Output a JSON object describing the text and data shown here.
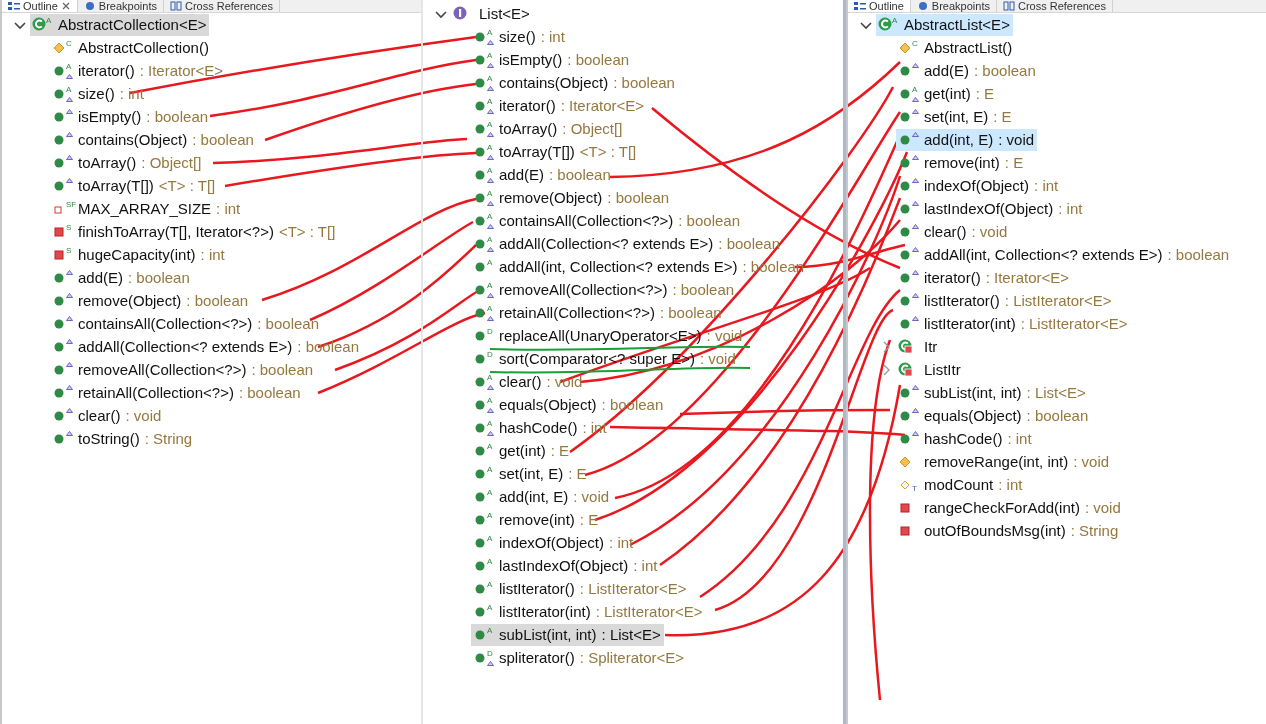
{
  "panels": [
    {
      "focused": false,
      "tabs": [
        {
          "label": "Outline",
          "kind": "outline",
          "closable": true,
          "selected": true
        },
        {
          "label": "Breakpoints",
          "kind": "breakpoints",
          "closable": false,
          "selected": false
        },
        {
          "label": "Cross References",
          "kind": "references",
          "closable": false,
          "selected": false
        }
      ],
      "tree": {
        "kind": "class",
        "badge": "A",
        "overrides": false,
        "name": "AbstractCollection<E>",
        "selected": true,
        "expanded": true,
        "children": [
          {
            "kind": "protected-method",
            "badge": "C",
            "overrides": false,
            "name": "AbstractCollection()",
            "selected": false
          },
          {
            "kind": "public-method",
            "badge": "A",
            "overrides": true,
            "name": "iterator()",
            "suffix": ": Iterator<E>",
            "selected": false
          },
          {
            "kind": "public-method",
            "badge": "A",
            "overrides": true,
            "name": "size()",
            "suffix": ": int",
            "selected": false
          },
          {
            "kind": "public-method",
            "overrides": true,
            "name": "isEmpty()",
            "suffix": ": boolean",
            "selected": false
          },
          {
            "kind": "public-method",
            "overrides": true,
            "name": "contains(Object)",
            "suffix": ": boolean",
            "selected": false
          },
          {
            "kind": "public-method",
            "overrides": true,
            "name": "toArray()",
            "suffix": ": Object[]",
            "selected": false
          },
          {
            "kind": "public-method",
            "overrides": true,
            "name": "toArray(T[])",
            "suffix": "<T> : T[]",
            "selected": false
          },
          {
            "kind": "private-field",
            "badge": "SF",
            "overrides": false,
            "name": "MAX_ARRAY_SIZE",
            "suffix": ": int",
            "selected": false
          },
          {
            "kind": "private-method",
            "badge": "S",
            "overrides": false,
            "name": "finishToArray(T[], Iterator<?>)",
            "suffix": "<T> : T[]",
            "selected": false
          },
          {
            "kind": "private-method",
            "badge": "S",
            "overrides": false,
            "name": "hugeCapacity(int)",
            "suffix": ": int",
            "selected": false
          },
          {
            "kind": "public-method",
            "overrides": true,
            "name": "add(E)",
            "suffix": ": boolean",
            "selected": false
          },
          {
            "kind": "public-method",
            "overrides": true,
            "name": "remove(Object)",
            "suffix": ": boolean",
            "selected": false
          },
          {
            "kind": "public-method",
            "overrides": true,
            "name": "containsAll(Collection<?>)",
            "suffix": ": boolean",
            "selected": false
          },
          {
            "kind": "public-method",
            "overrides": true,
            "name": "addAll(Collection<? extends E>)",
            "suffix": ": boolean",
            "selected": false
          },
          {
            "kind": "public-method",
            "overrides": true,
            "name": "removeAll(Collection<?>)",
            "suffix": ": boolean",
            "selected": false
          },
          {
            "kind": "public-method",
            "overrides": true,
            "name": "retainAll(Collection<?>)",
            "suffix": ": boolean",
            "selected": false
          },
          {
            "kind": "public-method",
            "overrides": true,
            "name": "clear()",
            "suffix": ": void",
            "selected": false
          },
          {
            "kind": "public-method",
            "overrides": true,
            "name": "toString()",
            "suffix": ": String",
            "selected": false
          }
        ]
      }
    },
    {
      "focused": false,
      "tree": {
        "kind": "interface",
        "overrides": false,
        "name": "List<E>",
        "selected": false,
        "expanded": true,
        "children": [
          {
            "kind": "public-method",
            "badge": "A",
            "overrides": true,
            "name": "size()",
            "suffix": ": int",
            "selected": false
          },
          {
            "kind": "public-method",
            "badge": "A",
            "overrides": true,
            "name": "isEmpty()",
            "suffix": ": boolean",
            "selected": false
          },
          {
            "kind": "public-method",
            "badge": "A",
            "overrides": true,
            "name": "contains(Object)",
            "suffix": ": boolean",
            "selected": false
          },
          {
            "kind": "public-method",
            "badge": "A",
            "overrides": true,
            "name": "iterator()",
            "suffix": ": Iterator<E>",
            "selected": false
          },
          {
            "kind": "public-method",
            "badge": "A",
            "overrides": true,
            "name": "toArray()",
            "suffix": ": Object[]",
            "selected": false
          },
          {
            "kind": "public-method",
            "badge": "A",
            "overrides": true,
            "name": "toArray(T[])",
            "suffix": "<T> : T[]",
            "selected": false
          },
          {
            "kind": "public-method",
            "badge": "A",
            "overrides": true,
            "name": "add(E)",
            "suffix": ": boolean",
            "selected": false
          },
          {
            "kind": "public-method",
            "badge": "A",
            "overrides": true,
            "name": "remove(Object)",
            "suffix": ": boolean",
            "selected": false
          },
          {
            "kind": "public-method",
            "badge": "A",
            "overrides": true,
            "name": "containsAll(Collection<?>)",
            "suffix": ": boolean",
            "selected": false
          },
          {
            "kind": "public-method",
            "badge": "A",
            "overrides": true,
            "name": "addAll(Collection<? extends E>)",
            "suffix": ": boolean",
            "selected": false
          },
          {
            "kind": "public-method",
            "badge": "A",
            "overrides": false,
            "name": "addAll(int, Collection<? extends E>)",
            "suffix": ": boolean",
            "selected": false
          },
          {
            "kind": "public-method",
            "badge": "A",
            "overrides": true,
            "name": "removeAll(Collection<?>)",
            "suffix": ": boolean",
            "selected": false
          },
          {
            "kind": "public-method",
            "badge": "A",
            "overrides": true,
            "name": "retainAll(Collection<?>)",
            "suffix": ": boolean",
            "selected": false
          },
          {
            "kind": "public-method",
            "badge": "D",
            "overrides": false,
            "name": "replaceAll(UnaryOperator<E>)",
            "suffix": ": void",
            "selected": false
          },
          {
            "kind": "public-method",
            "badge": "D",
            "overrides": false,
            "name": "sort(Comparator<? super E>)",
            "suffix": ": void",
            "selected": false
          },
          {
            "kind": "public-method",
            "badge": "A",
            "overrides": true,
            "name": "clear()",
            "suffix": ": void",
            "selected": false
          },
          {
            "kind": "public-method",
            "badge": "A",
            "overrides": true,
            "name": "equals(Object)",
            "suffix": ": boolean",
            "selected": false
          },
          {
            "kind": "public-method",
            "badge": "A",
            "overrides": true,
            "name": "hashCode()",
            "suffix": ": int",
            "selected": false
          },
          {
            "kind": "public-method",
            "badge": "A",
            "overrides": false,
            "name": "get(int)",
            "suffix": ": E",
            "selected": false
          },
          {
            "kind": "public-method",
            "badge": "A",
            "overrides": false,
            "name": "set(int, E)",
            "suffix": ": E",
            "selected": false
          },
          {
            "kind": "public-method",
            "badge": "A",
            "overrides": false,
            "name": "add(int, E)",
            "suffix": ": void",
            "selected": false
          },
          {
            "kind": "public-method",
            "badge": "A",
            "overrides": false,
            "name": "remove(int)",
            "suffix": ": E",
            "selected": false
          },
          {
            "kind": "public-method",
            "badge": "A",
            "overrides": false,
            "name": "indexOf(Object)",
            "suffix": ": int",
            "selected": false
          },
          {
            "kind": "public-method",
            "badge": "A",
            "overrides": false,
            "name": "lastIndexOf(Object)",
            "suffix": ": int",
            "selected": false
          },
          {
            "kind": "public-method",
            "badge": "A",
            "overrides": false,
            "name": "listIterator()",
            "suffix": ": ListIterator<E>",
            "selected": false
          },
          {
            "kind": "public-method",
            "badge": "A",
            "overrides": false,
            "name": "listIterator(int)",
            "suffix": ": ListIterator<E>",
            "selected": false
          },
          {
            "kind": "public-method",
            "badge": "A",
            "overrides": false,
            "name": "subList(int, int)",
            "suffix": ": List<E>",
            "selected": true
          },
          {
            "kind": "public-method",
            "badge": "D",
            "overrides": true,
            "name": "spliterator()",
            "suffix": ": Spliterator<E>",
            "selected": false
          }
        ]
      }
    },
    {
      "focused": true,
      "tabs": [
        {
          "label": "Outline",
          "kind": "outline",
          "closable": false,
          "selected": true
        },
        {
          "label": "Breakpoints",
          "kind": "breakpoints",
          "closable": false,
          "selected": false
        },
        {
          "label": "Cross References",
          "kind": "references",
          "closable": false,
          "selected": false
        }
      ],
      "tree": {
        "kind": "class",
        "badge": "A",
        "overrides": false,
        "name": "AbstractList<E>",
        "selected": true,
        "expanded": true,
        "children": [
          {
            "kind": "protected-method",
            "badge": "C",
            "overrides": false,
            "name": "AbstractList()",
            "selected": false
          },
          {
            "kind": "public-method",
            "overrides": true,
            "name": "add(E)",
            "suffix": ": boolean",
            "selected": false
          },
          {
            "kind": "public-method",
            "badge": "A",
            "overrides": true,
            "name": "get(int)",
            "suffix": ": E",
            "selected": false
          },
          {
            "kind": "public-method",
            "overrides": true,
            "name": "set(int, E)",
            "suffix": ": E",
            "selected": false
          },
          {
            "kind": "public-method",
            "overrides": true,
            "name": "add(int, E)",
            "suffix": ": void",
            "selected": true
          },
          {
            "kind": "public-method",
            "overrides": true,
            "name": "remove(int)",
            "suffix": ": E",
            "selected": false
          },
          {
            "kind": "public-method",
            "overrides": true,
            "name": "indexOf(Object)",
            "suffix": ": int",
            "selected": false
          },
          {
            "kind": "public-method",
            "overrides": true,
            "name": "lastIndexOf(Object)",
            "suffix": ": int",
            "selected": false
          },
          {
            "kind": "public-method",
            "overrides": true,
            "name": "clear()",
            "suffix": ": void",
            "selected": false
          },
          {
            "kind": "public-method",
            "overrides": true,
            "name": "addAll(int, Collection<? extends E>)",
            "suffix": ": boolean",
            "selected": false
          },
          {
            "kind": "public-method",
            "overrides": true,
            "name": "iterator()",
            "suffix": ": Iterator<E>",
            "selected": false
          },
          {
            "kind": "public-method",
            "overrides": true,
            "name": "listIterator()",
            "suffix": ": ListIterator<E>",
            "selected": false
          },
          {
            "kind": "public-method",
            "overrides": true,
            "name": "listIterator(int)",
            "suffix": ": ListIterator<E>",
            "selected": false
          },
          {
            "kind": "private-class",
            "overrides": false,
            "name": "Itr",
            "selected": false,
            "expanded": false
          },
          {
            "kind": "private-class",
            "overrides": false,
            "name": "ListItr",
            "selected": false,
            "expanded": false
          },
          {
            "kind": "public-method",
            "overrides": true,
            "name": "subList(int, int)",
            "suffix": ": List<E>",
            "selected": false
          },
          {
            "kind": "public-method",
            "overrides": true,
            "name": "equals(Object)",
            "suffix": ": boolean",
            "selected": false
          },
          {
            "kind": "public-method",
            "overrides": true,
            "name": "hashCode()",
            "suffix": ": int",
            "selected": false
          },
          {
            "kind": "protected-method",
            "overrides": false,
            "name": "removeRange(int, int)",
            "suffix": ": void",
            "selected": false
          },
          {
            "kind": "default-field",
            "badge": "T",
            "overrides": false,
            "name": "modCount",
            "suffix": ": int",
            "selected": false
          },
          {
            "kind": "private-method",
            "overrides": false,
            "name": "rangeCheckForAdd(int)",
            "suffix": ": void",
            "selected": false
          },
          {
            "kind": "private-method",
            "overrides": false,
            "name": "outOfBoundsMsg(int)",
            "suffix": ": String",
            "selected": false
          }
        ]
      }
    }
  ]
}
